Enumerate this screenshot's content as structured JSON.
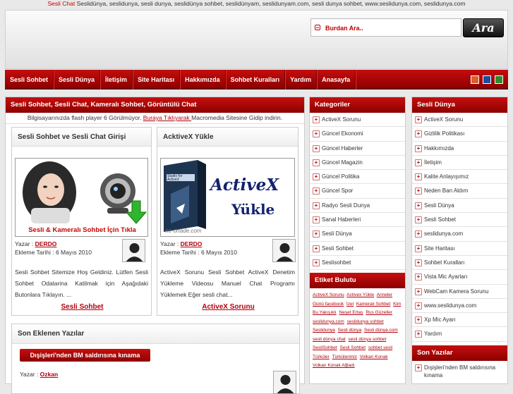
{
  "top_bar": {
    "highlight": "Sesli Chat",
    "text": " Seslidünya, seslidunya, sesli dunya, seslidünya sohbet, seslidünyam, seslidunyam.com, sesli dunya sohbet, www.seslidunya.com, seslidunya.com"
  },
  "search": {
    "placeholder": "Burdan Ara..",
    "button_label": "Ara"
  },
  "nav": {
    "items": [
      "Sesli Sohbet",
      "Sesli Dünya",
      "İletişim",
      "Site Haritası",
      "Hakkımızda",
      "Sohbet Kuralları",
      "Yardım",
      "Anasayfa"
    ]
  },
  "theme_colors": [
    "#e05e2a",
    "#1d4e9e",
    "#2e8b2e"
  ],
  "main": {
    "title": "Sesli Sohbet, Sesli Chat, Kameralı Sohbet, Görüntülü Chat",
    "flash_notice": {
      "before": "Bilgisayarınızda flash player 6 Görülmüyor. ",
      "link": "Buraya Tıklıyarak ",
      "after": "Macromedia Sitesine Gidip indirin."
    },
    "cards": [
      {
        "title": "Sesli Sohbet ve Sesli Chat Girişi",
        "image_caption": "Sesli & Kameralı Sohbet İçin Tıkla",
        "author_label": "Yazar : ",
        "author": "DERDO",
        "date": "Ekleme Tarihi : 6 Mayıs 2010",
        "desc": "Sesli Sohbet Sitemize Hoş Geldiniz. Lütfen Sesli Sohbet Odalarina Katilmak için Aşağıdaki Butonlara Tıklayın. ...",
        "cta": "Sesli Sohbet"
      },
      {
        "title": "AcktiveX Yükle",
        "image_line1": "ActiveX",
        "image_line2": "Yükle",
        "image_small": "Studio for ActiveX",
        "image_url": "ne-ortade.com",
        "author_label": "Yazar : ",
        "author": "DERDO",
        "date": "Ekleme Tarihi : 6 Mayıs 2010",
        "desc": "ActiveX Sorunu Sesli Sohbet ActiveX Denetim Yükleme Videosu Manuel Chat Programı Yüklemek Eğer sesli chat...",
        "cta": "ActiveX Sorunu"
      }
    ],
    "recent": {
      "title": "Son Eklenen Yazılar",
      "item": "Dışişleri'nden BM saldırısına kınama",
      "author_label": "Yazar : ",
      "author": "Ozkan"
    }
  },
  "kategoriler": {
    "title": "Kategoriler",
    "items": [
      "ActiveX Sorunu",
      "Güncel Ekonomi",
      "Güncel Haberler",
      "Güncel Magazin",
      "Güncel Politika",
      "Güncel Spor",
      "Radyo Sesli Dunya",
      "Sanal Haberleri",
      "Sesli Dünya",
      "Sesli Sohbet",
      "Seslisohbet"
    ]
  },
  "etiket": {
    "title": "Etiket Bulutu",
    "tags": [
      "ActiveX Sorunu",
      "Activex Yükle",
      "Anneler Günü facebook",
      "İzel",
      "Kameralı Sohbet",
      "Kim Bu Yakışıklı",
      "Neşet Ertaş",
      "Rus Güzeller",
      "seslidunya.com",
      "seslidunya sohbet",
      "Seslidunya",
      "Sesli dünya",
      "Sesli dünya.com",
      "sesli dünya chat",
      "sesli dünya sohbet",
      "SesliSohbet",
      "Sesli Sohbet",
      "sohbet sesli",
      "Türküler",
      "Türkülerimiz",
      "Volkan Konak",
      "Volkan Konak Ağladı"
    ]
  },
  "sesli_dunya": {
    "title": "Sesli Dünya",
    "items": [
      "ActiveX Sorunu",
      "Gizlilik Politikası",
      "Hakkımızda",
      "İletişim",
      "Kalite Anlayışımız",
      "Neden Ban Aldım",
      "Sesli Dünya",
      "Sesli Sohbet",
      "seslidunya.com",
      "Site Haritası",
      "Sohbet Kuralları",
      "Vista Mic Ayarları",
      "WebCam Kamera Sorunu",
      "www.seslidunya.com",
      "Xp Mic Ayarı",
      "Yardım"
    ]
  },
  "son_yazilar": {
    "title": "Son Yazılar",
    "items": [
      "Dışişleri'nden BM saldırısına kınama"
    ]
  }
}
